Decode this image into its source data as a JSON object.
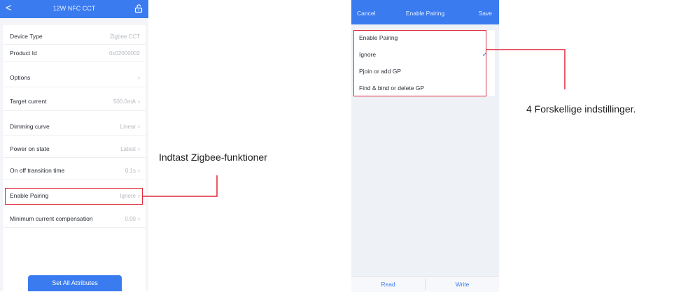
{
  "left": {
    "header": {
      "back_glyph": "<",
      "title": "12W NFC CCT",
      "unlock_icon": "unlock-icon"
    },
    "rows": [
      {
        "label": "Device Type",
        "value": "Zigbee CCT",
        "chevron": false
      },
      {
        "label": "Product Id",
        "value": "0x02000002",
        "chevron": false
      },
      {
        "label": "Options",
        "value": "",
        "chevron": true
      },
      {
        "label": "Target current",
        "value": "500.0mA",
        "chevron": true
      },
      {
        "label": "Dimming curve",
        "value": "Linear",
        "chevron": true
      },
      {
        "label": "Power on state",
        "value": "Latest",
        "chevron": true
      },
      {
        "label": "On off transition time",
        "value": "0.1s",
        "chevron": true
      },
      {
        "label": "Enable Pairing",
        "value": "Ignore",
        "chevron": true
      },
      {
        "label": "Minimum current compensation",
        "value": "0.00",
        "chevron": true
      }
    ],
    "button_label": "Set All Attributes",
    "annotation": "Indtast Zigbee-funktioner"
  },
  "right": {
    "header": {
      "cancel": "Cancel",
      "title": "Enable Pairing",
      "save": "Save"
    },
    "items": [
      {
        "label": "Enable Pairing",
        "checked": false
      },
      {
        "label": "Ignore",
        "checked": true
      },
      {
        "label": "Pjoin or add GP",
        "checked": false
      },
      {
        "label": "Find & bind or delete GP",
        "checked": false
      }
    ],
    "footer": {
      "read": "Read",
      "write": "Write"
    },
    "annotation": "4 Forskellige indstillinger."
  },
  "colors": {
    "accent": "#3a7bf0",
    "highlight": "#e0283a"
  }
}
